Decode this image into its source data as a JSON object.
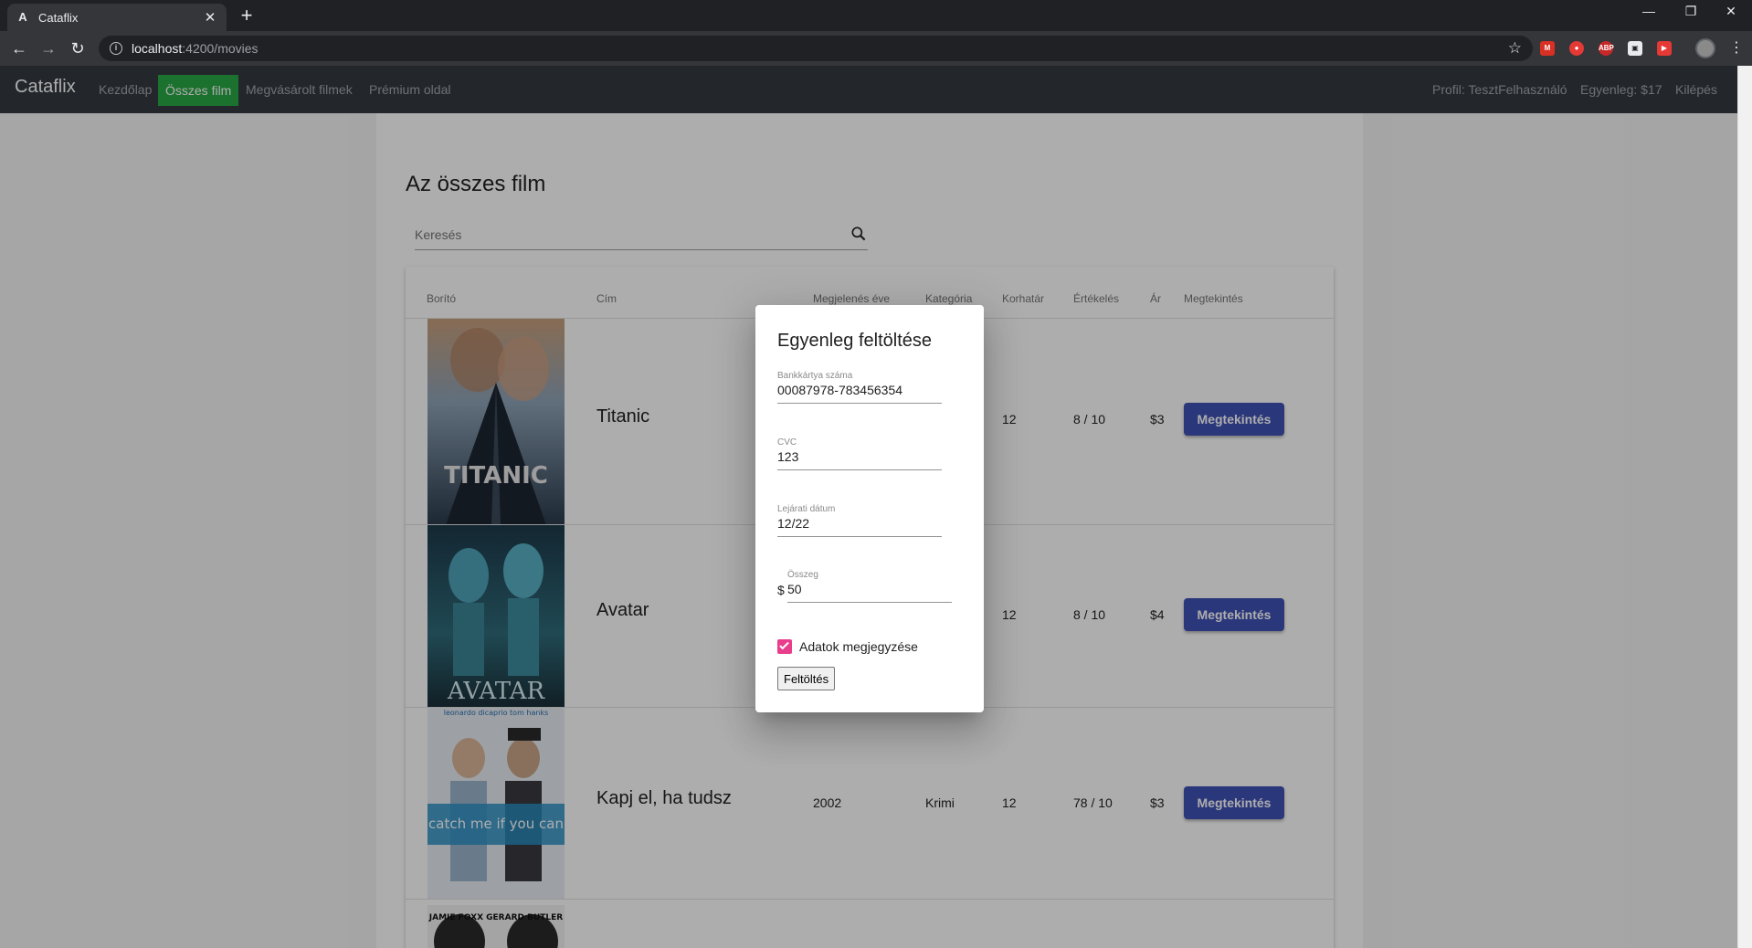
{
  "browser": {
    "tab_title": "Cataflix",
    "url_host": "localhost",
    "url_path": ":4200/movies"
  },
  "app": {
    "brand": "Cataflix",
    "nav": {
      "home": "Kezdőlap",
      "all_movies": "Összes film",
      "purchased": "Megvásárolt filmek",
      "premium": "Prémium oldal"
    },
    "profile": "Profil: TesztFelhasználó",
    "balance": "Egyenleg: $17",
    "logout": "Kilépés"
  },
  "page": {
    "title": "Az összes film",
    "search_placeholder": "Keresés"
  },
  "table": {
    "headers": {
      "cover": "Borító",
      "title": "Cím",
      "year": "Megjelenés éve",
      "category": "Kategória",
      "age": "Korhatár",
      "rating": "Értékelés",
      "price": "Ár",
      "watch": "Megtekintés"
    },
    "rows": [
      {
        "title": "Titanic",
        "year": "",
        "category": "",
        "age": "12",
        "rating": "8 / 10",
        "price": "$3",
        "button": "Megtekintés",
        "poster_text": "TITANIC"
      },
      {
        "title": "Avatar",
        "year": "",
        "category": "",
        "age": "12",
        "rating": "8 / 10",
        "price": "$4",
        "button": "Megtekintés",
        "poster_text": "AVATAR"
      },
      {
        "title": "Kapj el, ha tudsz",
        "year": "2002",
        "category": "Krimi",
        "age": "12",
        "rating": "78 / 10",
        "price": "$3",
        "button": "Megtekintés",
        "poster_text": "catch me if you can",
        "poster_top": "leonardo dicaprio    tom hanks"
      },
      {
        "poster_text": "JAMIE FOXX  GERARD BUTLER"
      }
    ]
  },
  "dialog": {
    "title": "Egyenleg feltöltése",
    "card_label": "Bankkártya száma",
    "card_value": "00087978-783456354",
    "cvc_label": "CVC",
    "cvc_value": "123",
    "expiry_label": "Lejárati dátum",
    "expiry_value": "12/22",
    "amount_label": "Összeg",
    "amount_prefix": "$",
    "amount_value": "50",
    "remember_label": "Adatok megjegyzése",
    "remember_checked": true,
    "submit_label": "Feltöltés"
  },
  "colors": {
    "navbar": "#343a40",
    "active_nav": "#28a745",
    "primary_button": "#3f51b5",
    "checkbox": "#e83e8c"
  }
}
